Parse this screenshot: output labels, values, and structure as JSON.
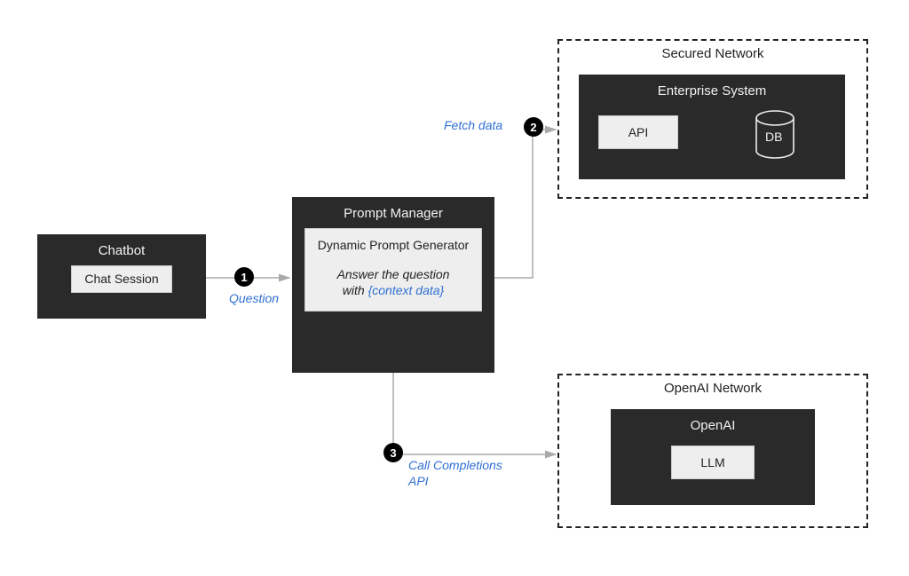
{
  "nodes": {
    "chatbot": {
      "title": "Chatbot",
      "inner": "Chat Session"
    },
    "prompt_manager": {
      "title": "Prompt Manager",
      "gen_title": "Dynamic Prompt Generator",
      "gen_line1": "Answer the question",
      "gen_line2_prefix": "with ",
      "gen_line2_var": "{context data}"
    },
    "secured_network": {
      "title": "Secured Network",
      "enterprise_title": "Enterprise System",
      "api_label": "API",
      "db_label": "DB"
    },
    "openai_network": {
      "title": "OpenAI Network",
      "openai_title": "OpenAI",
      "llm_label": "LLM"
    }
  },
  "edges": {
    "one": {
      "badge": "1",
      "label": "Question"
    },
    "two": {
      "badge": "2",
      "label": "Fetch data"
    },
    "three": {
      "badge": "3",
      "label_line1": "Call Completions",
      "label_line2": "API"
    }
  }
}
